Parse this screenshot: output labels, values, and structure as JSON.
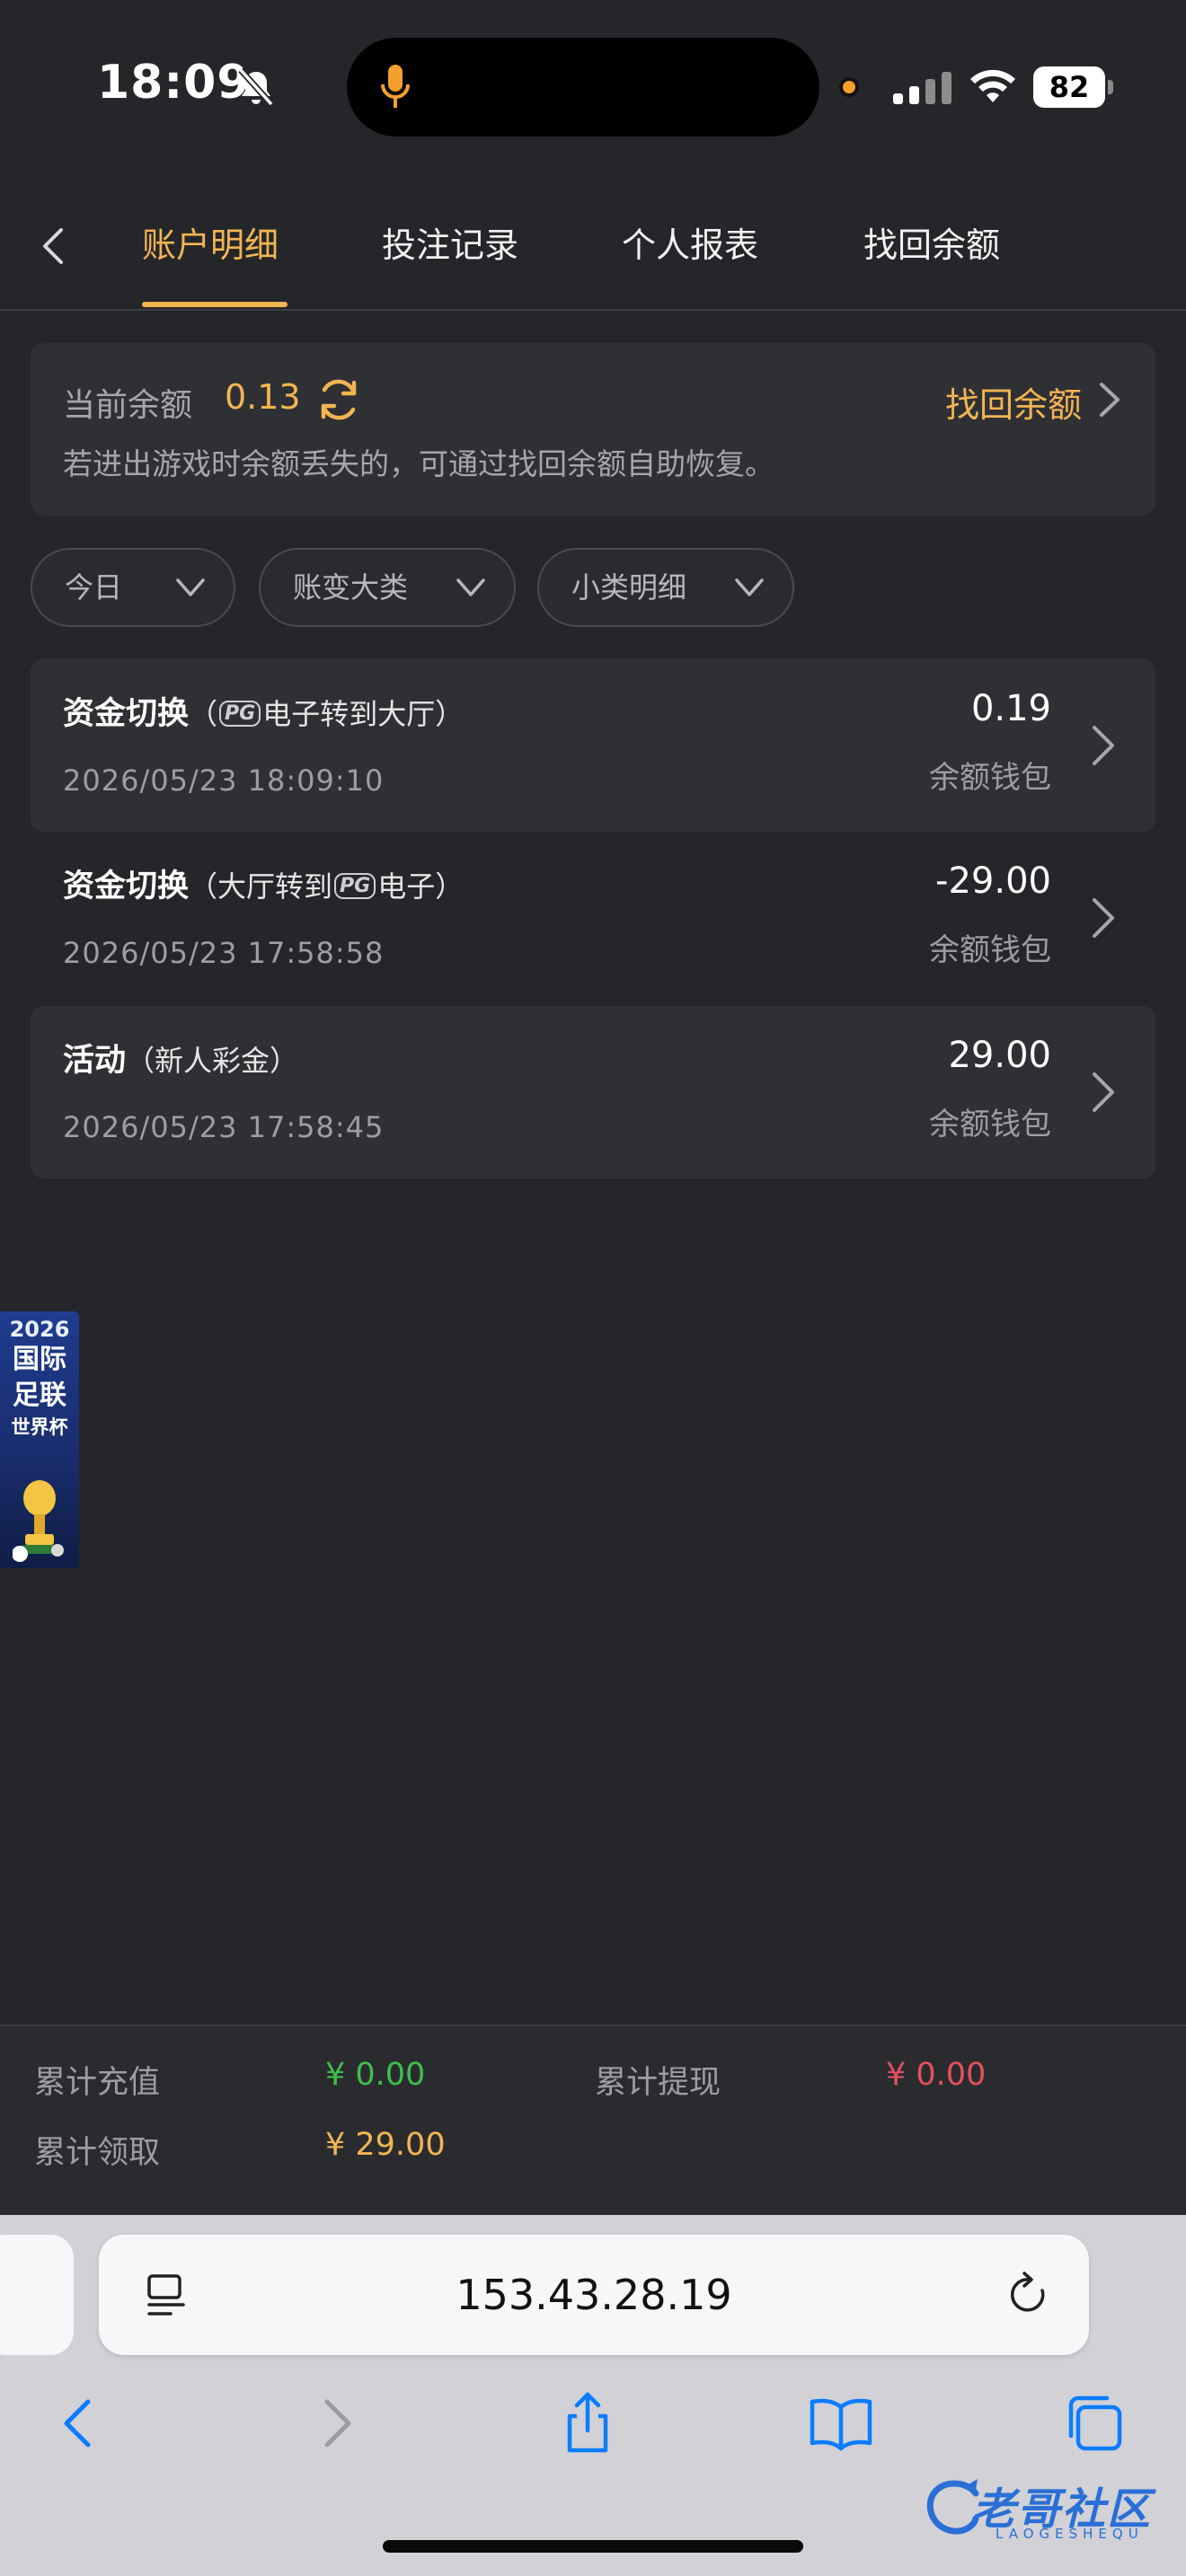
{
  "status_bar": {
    "time": "18:09",
    "battery": "82",
    "icons": [
      "bell-slash-icon",
      "microphone-icon",
      "signal-icon",
      "wifi-icon",
      "battery-icon"
    ]
  },
  "tabs": [
    {
      "label": "账户明细",
      "active": true
    },
    {
      "label": "投注记录",
      "active": false
    },
    {
      "label": "个人报表",
      "active": false
    },
    {
      "label": "找回余额",
      "active": false
    }
  ],
  "balance": {
    "label": "当前余额",
    "value": "0.13",
    "recover_label": "找回余额",
    "note": "若进出游戏时余额丢失的，可通过找回余额自助恢复。"
  },
  "filters": [
    {
      "label": "今日"
    },
    {
      "label": "账变大类"
    },
    {
      "label": "小类明细"
    }
  ],
  "records": [
    {
      "title": "资金切换",
      "sub_prefix": "（",
      "sub_logo": "PG",
      "sub_rest": "电子转到大厅）",
      "date": "2026/05/23 18:09:10",
      "amount": "0.19",
      "wallet": "余额钱包"
    },
    {
      "title": "资金切换",
      "sub_prefix": "（大厅转到",
      "sub_logo": "PG",
      "sub_rest": "电子）",
      "date": "2026/05/23 17:58:58",
      "amount": "-29.00",
      "wallet": "余额钱包"
    },
    {
      "title": "活动",
      "sub_prefix": "（新人彩金）",
      "sub_logo": "",
      "sub_rest": "",
      "date": "2026/05/23 17:58:45",
      "amount": "29.00",
      "wallet": "余额钱包"
    }
  ],
  "banner": {
    "year": "2026",
    "line1": "国际",
    "line2": "足联",
    "line3": "世界杯"
  },
  "totals": {
    "recharge_label": "累计充值",
    "recharge_value": "¥ 0.00",
    "withdraw_label": "累计提现",
    "withdraw_value": "¥ 0.00",
    "claim_label": "累计领取",
    "claim_value": "¥ 29.00"
  },
  "browser": {
    "url": "153.43.28.19"
  },
  "watermark": {
    "text": "老哥社区",
    "sub": "LAOGESHEQU"
  },
  "colors": {
    "accent": "#f2b552",
    "positive": "#3fbf4a",
    "negative": "#e5505c",
    "background": "#25262a",
    "card": "#2f3034",
    "safari_blue": "#0a7cff"
  }
}
